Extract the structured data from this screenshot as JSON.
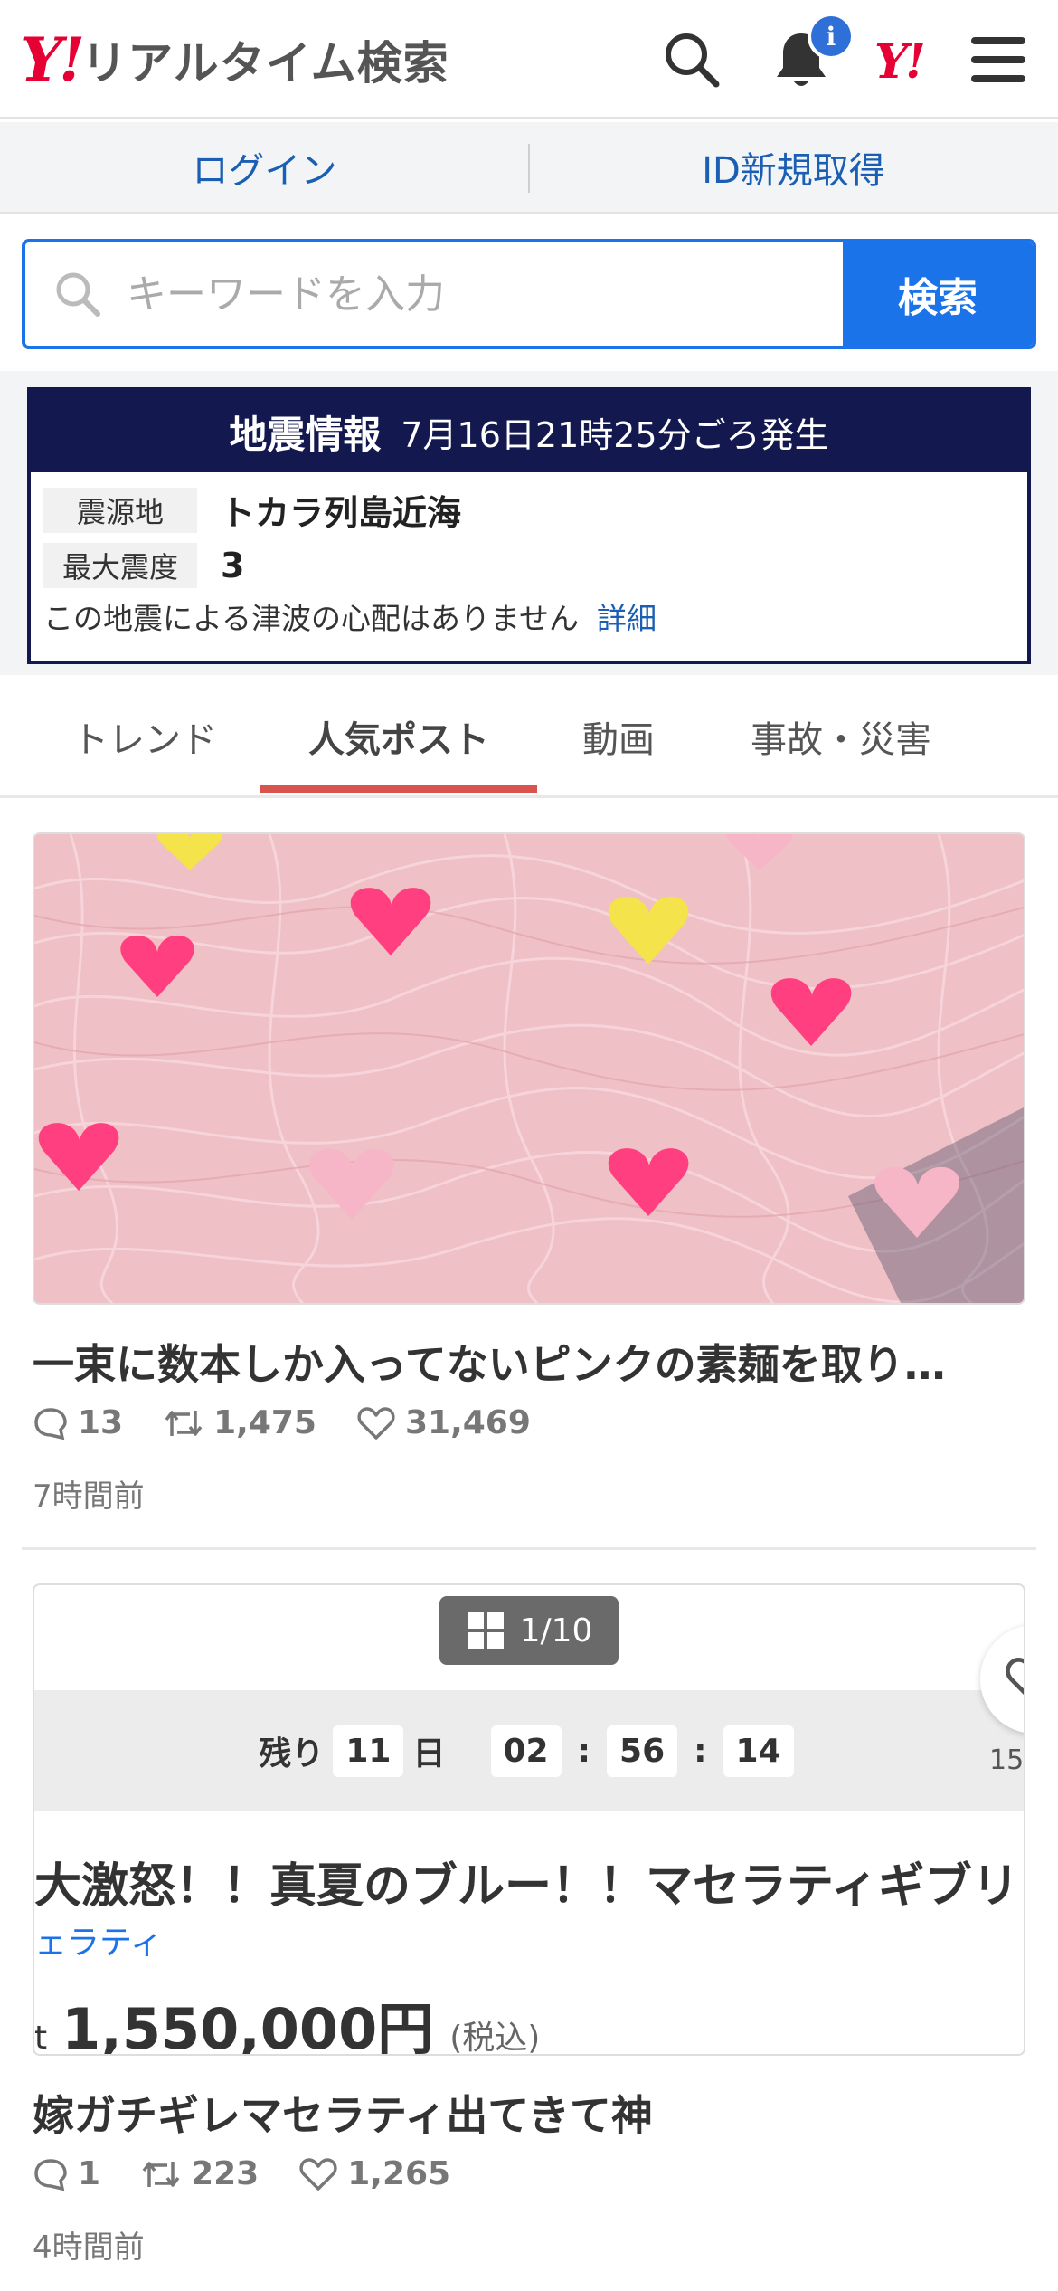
{
  "header": {
    "logo_mark": "Y!",
    "service_name": "リアルタイム検索",
    "notification_badge": "i",
    "yj_mark": "Y!"
  },
  "account": {
    "login_label": "ログイン",
    "register_label": "ID新規取得"
  },
  "search": {
    "placeholder": "キーワードを入力",
    "button_label": "検索"
  },
  "earthquake": {
    "title": "地震情報",
    "time": "7月16日21時25分ごろ発生",
    "epicenter_label": "震源地",
    "epicenter_value": "トカラ列島近海",
    "intensity_label": "最大震度",
    "intensity_value": "3",
    "tsunami_note": "この地震による津波の心配はありません",
    "detail_link": "詳細"
  },
  "tabs": [
    {
      "label": "トレンド",
      "active": false
    },
    {
      "label": "人気ポスト",
      "active": true
    },
    {
      "label": "動画",
      "active": false
    },
    {
      "label": "事故・災害",
      "active": false
    }
  ],
  "posts": [
    {
      "title": "一束に数本しか入ってないピンクの素麺を取り…",
      "replies": "13",
      "reposts": "1,475",
      "likes": "31,469",
      "time_ago": "7時間前"
    },
    {
      "title": "嫁ガチギレマセラティ出てきて神",
      "replies": "1",
      "reposts": "223",
      "likes": "1,265",
      "time_ago": "4時間前",
      "image": {
        "counter": "1/10",
        "remain_label": "残り",
        "days": "11",
        "day_unit": "日",
        "hours": "02",
        "minutes": "56",
        "seconds": "14",
        "listing_title": "大激怒！！真夏のブルー！！マセラティギブリ",
        "brand": "ェラティ",
        "price_prefix": "t",
        "price": "1,550,000円",
        "tax_note": "(税込)",
        "fav_count": "15"
      }
    }
  ],
  "colors": {
    "yahoo_red": "#e60033",
    "link_blue": "#1a5fb4",
    "search_blue": "#1a73e8",
    "quake_navy": "#13184f",
    "tab_accent": "#d9534f"
  }
}
